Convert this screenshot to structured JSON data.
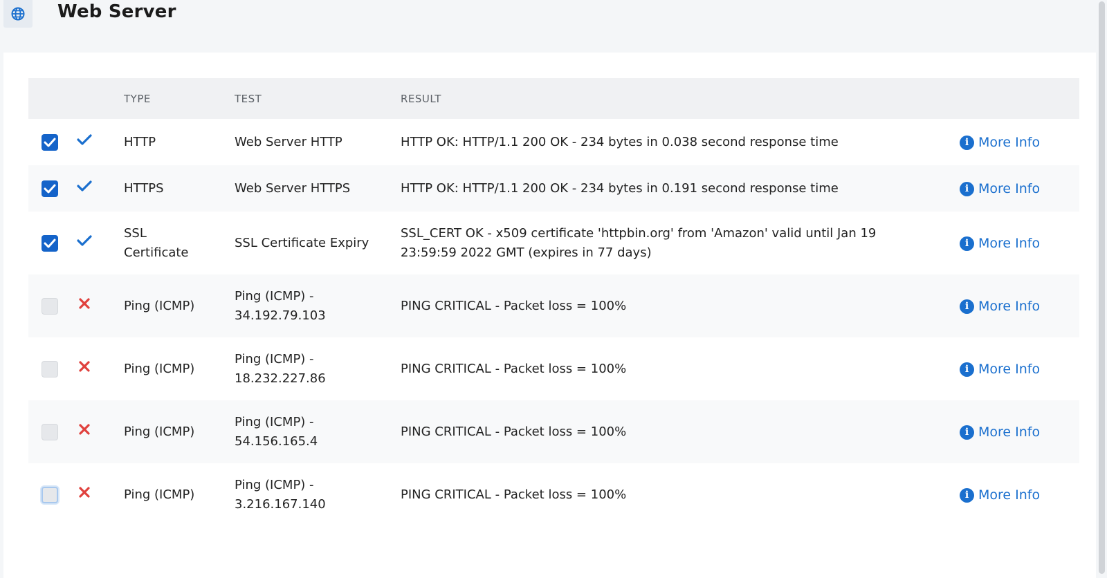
{
  "header": {
    "icon": "globe-icon",
    "title": "Web Server"
  },
  "colors": {
    "accent": "#1a6fce",
    "checkbox_checked": "#1463c9",
    "ok": "#1a6fce",
    "critical": "#e0413d"
  },
  "table": {
    "columns": {
      "select": "",
      "status": "",
      "type": "TYPE",
      "test": "TEST",
      "result": "RESULT",
      "action": ""
    },
    "rows": [
      {
        "checked": true,
        "status": "ok",
        "status_icon": "checkmark-icon",
        "type": "HTTP",
        "test": "Web Server HTTP",
        "result": "HTTP OK: HTTP/1.1 200 OK - 234 bytes in 0.038 second response time",
        "action": "More Info"
      },
      {
        "checked": true,
        "status": "ok",
        "status_icon": "checkmark-icon",
        "type": "HTTPS",
        "test": "Web Server HTTPS",
        "result": "HTTP OK: HTTP/1.1 200 OK - 234 bytes in 0.191 second response time",
        "action": "More Info"
      },
      {
        "checked": true,
        "status": "ok",
        "status_icon": "checkmark-icon",
        "type": "SSL Certificate",
        "test": "SSL Certificate Expiry",
        "result": "SSL_CERT OK - x509 certificate 'httpbin.org' from 'Amazon' valid until Jan 19 23:59:59 2022 GMT (expires in 77 days)",
        "action": "More Info"
      },
      {
        "checked": false,
        "status": "critical",
        "status_icon": "x-icon",
        "type": "Ping (ICMP)",
        "test": "Ping (ICMP) - 34.192.79.103",
        "result": "PING CRITICAL - Packet loss = 100%",
        "action": "More Info"
      },
      {
        "checked": false,
        "status": "critical",
        "status_icon": "x-icon",
        "type": "Ping (ICMP)",
        "test": "Ping (ICMP) - 18.232.227.86",
        "result": "PING CRITICAL - Packet loss = 100%",
        "action": "More Info"
      },
      {
        "checked": false,
        "status": "critical",
        "status_icon": "x-icon",
        "type": "Ping (ICMP)",
        "test": "Ping (ICMP) - 54.156.165.4",
        "result": "PING CRITICAL - Packet loss = 100%",
        "action": "More Info"
      },
      {
        "checked": false,
        "focused": true,
        "status": "critical",
        "status_icon": "x-icon",
        "type": "Ping (ICMP)",
        "test": "Ping (ICMP) - 3.216.167.140",
        "result": "PING CRITICAL - Packet loss = 100%",
        "action": "More Info"
      }
    ]
  }
}
